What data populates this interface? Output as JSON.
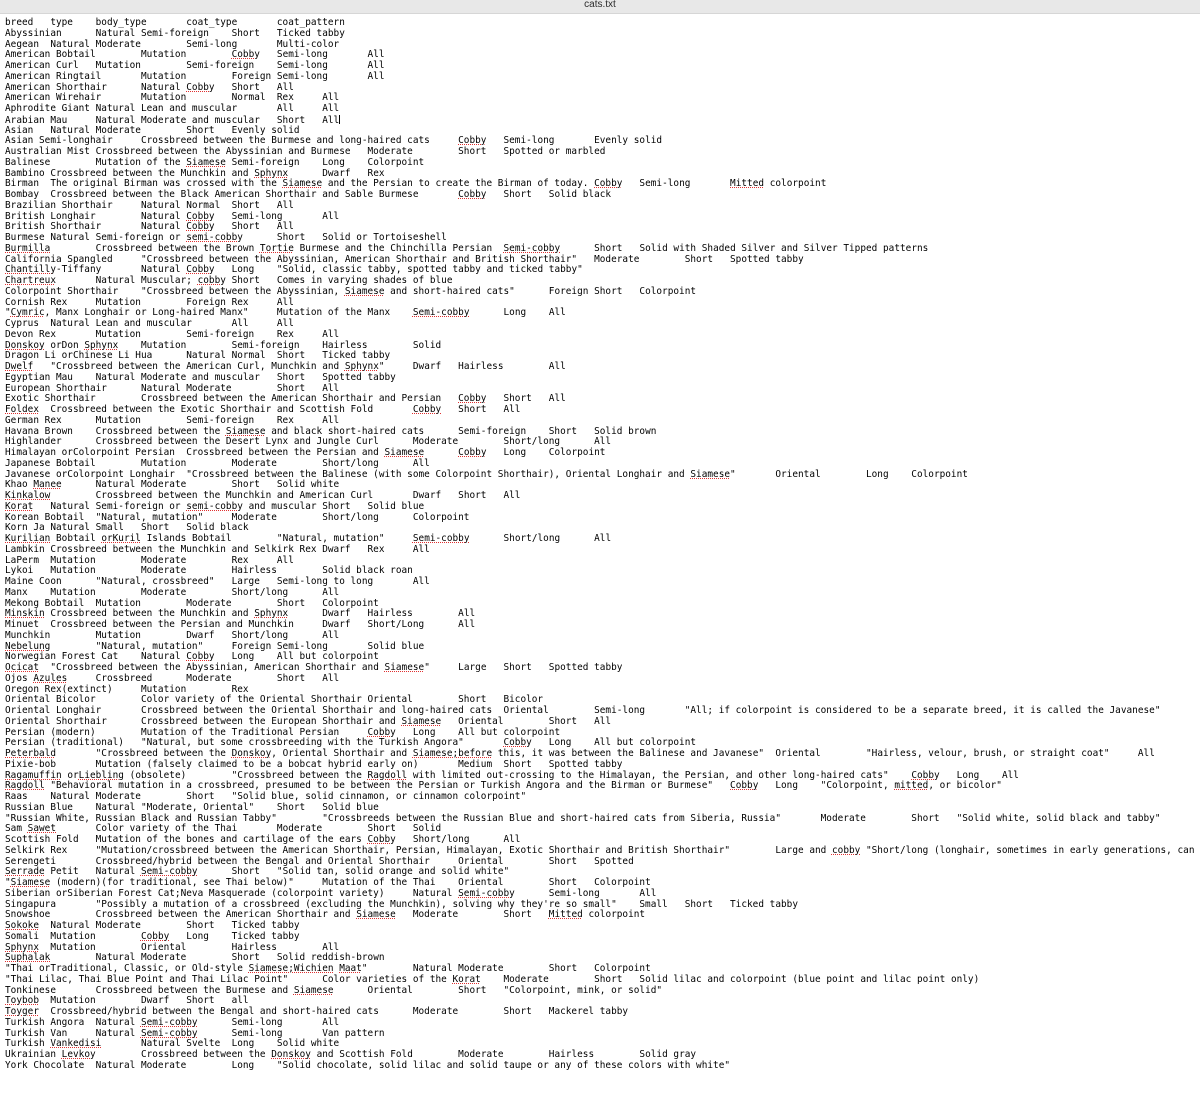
{
  "window": {
    "title": "cats.txt"
  },
  "editor": {
    "tab_size": 8,
    "caret_line_index": 10,
    "misspelled_words": [
      "Cobby",
      "cobby",
      "Sphynx",
      "Mitted",
      "mitted",
      "Burmilla",
      "Tortie",
      "Semi-cobby",
      "semi-cobby",
      "Chantilly",
      "Chartreux",
      "Cymric",
      "Donskoy",
      "Dwelf",
      "Foldex",
      "Manee",
      "Kinkalow",
      "Korat",
      "Kuril",
      "Kurilian",
      "Minskin",
      "Nebelung",
      "Ocicat",
      "Azules",
      "Peterbald",
      "Siamese",
      "Ragdoll",
      "Ragamuffin",
      "Liebling",
      "Sawet",
      "Serrade",
      "Siamese;Wichien",
      "Maat",
      "Sokoke",
      "Suphalak",
      "Toybob",
      "Toyger",
      "Vankedisi",
      "Levkoy",
      "Siamese;before",
      "orKuril",
      "Wichien"
    ],
    "colors": {
      "background": "#ffffff",
      "text": "#000000",
      "titlebar_background": "#e8e8e8",
      "spellcheck_underline": "#e03030"
    },
    "header_columns": [
      "breed",
      "type",
      "body_type",
      "coat_type",
      "coat_pattern"
    ],
    "lines": [
      "breed\ttype\tbody_type\tcoat_type\tcoat_pattern",
      "Abyssinian\tNatural\tSemi-foreign\tShort\tTicked tabby",
      "Aegean\tNatural\tModerate\tSemi-long\tMulti-color",
      "American Bobtail\tMutation\tCobby\tSemi-long\tAll",
      "American Curl\tMutation\tSemi-foreign\tSemi-long\tAll",
      "American Ringtail\tMutation\tForeign\tSemi-long\tAll",
      "American Shorthair\tNatural\tCobby\tShort\tAll",
      "American Wirehair\tMutation\tNormal\tRex\tAll",
      "Aphrodite Giant\tNatural\tLean and muscular\tAll\tAll",
      "Arabian Mau\tNatural\tModerate and muscular\tShort\tAll",
      "Asian\tNatural\tModerate\tShort\tEvenly solid",
      "Asian Semi-longhair\tCrossbreed between the Burmese and long-haired cats\tCobby\tSemi-long\tEvenly solid",
      "Australian Mist\tCrossbreed between the Abyssinian and Burmese\tModerate\tShort\tSpotted or marbled",
      "Balinese\tMutation of the Siamese\tSemi-foreign\tLong\tColorpoint",
      "Bambino\tCrossbreed between the Munchkin and Sphynx\tDwarf\tRex",
      "Birman\tThe original Birman was crossed with the Siamese and the Persian to create the Birman of today.\tCobby\tSemi-long\tMitted colorpoint",
      "Bombay\tCrossbreed between the Black American Shorthair and Sable Burmese\tCobby\tShort\tSolid black",
      "Brazilian Shorthair\tNatural\tNormal\tShort\tAll",
      "British Longhair\tNatural\tCobby\tSemi-long\tAll",
      "British Shorthair\tNatural\tCobby\tShort\tAll",
      "Burmese\tNatural\tSemi-foreign or semi-cobby\tShort\tSolid or Tortoiseshell",
      "Burmilla\tCrossbreed between the Brown Tortie Burmese and the Chinchilla Persian\tSemi-cobby\tShort\tSolid with Shaded Silver and Silver Tipped patterns",
      "California Spangled\t\"Crossbreed between the Abyssinian, American Shorthair and British Shorthair\"\tModerate\tShort\tSpotted tabby",
      "Chantilly-Tiffany\tNatural\tCobby\tLong\t\"Solid, classic tabby, spotted tabby and ticked tabby\"",
      "Chartreux\tNatural\tMuscular; cobby\tShort\tComes in varying shades of blue",
      "Colorpoint Shorthair\t\"Crossbreed between the Abyssinian, Siamese and short-haired cats\"\tForeign\tShort\tColorpoint",
      "Cornish Rex\tMutation\tForeign\tRex\tAll",
      "\"Cymric, Manx Longhair or Long-haired Manx\"\tMutation of the Manx\tSemi-cobby\tLong\tAll",
      "Cyprus\tNatural\tLean and muscular\tAll\tAll",
      "Devon Rex\tMutation\tSemi-foreign\tRex\tAll",
      "Donskoy orDon Sphynx\tMutation\tSemi-foreign\tHairless\tSolid",
      "Dragon Li orChinese Li Hua\tNatural\tNormal\tShort\tTicked tabby",
      "Dwelf\t\"Crossbreed between the American Curl, Munchkin and Sphynx\"\tDwarf\tHairless\tAll",
      "Egyptian Mau\tNatural\tModerate and muscular\tShort\tSpotted tabby",
      "European Shorthair\tNatural\tModerate\tShort\tAll",
      "Exotic Shorthair\tCrossbreed between the American Shorthair and Persian\tCobby\tShort\tAll",
      "Foldex\tCrossbreed between the Exotic Shorthair and Scottish Fold\tCobby\tShort\tAll",
      "German Rex\tMutation\tSemi-foreign\tRex\tAll",
      "Havana Brown\tCrossbreed between the Siamese and black short-haired cats\tSemi-foreign\tShort\tSolid brown",
      "Highlander\tCrossbreed between the Desert Lynx and Jungle Curl\tModerate\tShort/long\tAll",
      "Himalayan orColorpoint Persian\tCrossbreed between the Persian and Siamese\tCobby\tLong\tColorpoint",
      "Japanese Bobtail\tMutation\tModerate\tShort/long\tAll",
      "Javanese orColorpoint Longhair\t\"Crossbreed between the Balinese (with some Colorpoint Shorthair), Oriental Longhair and Siamese\"\tOriental\tLong\tColorpoint",
      "Khao Manee\tNatural\tModerate\tShort\tSolid white",
      "Kinkalow\tCrossbreed between the Munchkin and American Curl\tDwarf\tShort\tAll",
      "Korat\tNatural\tSemi-foreign or semi-cobby and muscular\tShort\tSolid blue",
      "Korean Bobtail\t\"Natural, mutation\"\tModerate\tShort/long\tColorpoint",
      "Korn Ja\tNatural\tSmall\tShort\tSolid black",
      "Kurilian Bobtail orKuril Islands Bobtail\t\"Natural, mutation\"\tSemi-cobby\tShort/long\tAll",
      "Lambkin\tCrossbreed between the Munchkin and Selkirk Rex\tDwarf\tRex\tAll",
      "LaPerm\tMutation\tModerate\tRex\tAll",
      "Lykoi\tMutation\tModerate\tHairless\tSolid black roan",
      "Maine Coon\t\"Natural, crossbreed\"\tLarge\tSemi-long to long\tAll",
      "Manx\tMutation\tModerate\tShort/long\tAll",
      "Mekong Bobtail\tMutation\tModerate\tShort\tColorpoint",
      "Minskin\tCrossbreed between the Munchkin and Sphynx\tDwarf\tHairless\tAll",
      "Minuet\tCrossbreed between the Persian and Munchkin\tDwarf\tShort/Long\tAll",
      "Munchkin\tMutation\tDwarf\tShort/long\tAll",
      "Nebelung\t\"Natural, mutation\"\tForeign\tSemi-long\tSolid blue",
      "Norwegian Forest Cat\tNatural\tCobby\tLong\tAll but colorpoint",
      "Ocicat\t\"Crossbreed between the Abyssinian, American Shorthair and Siamese\"\tLarge\tShort\tSpotted tabby",
      "Ojos Azules\tCrossbreed\tModerate\tShort\tAll",
      "Oregon Rex(extinct)\tMutation\tRex",
      "Oriental Bicolor\tColor variety of the Oriental Shorthair\tOriental\tShort\tBicolor",
      "Oriental Longhair\tCrossbreed between the Oriental Shorthair and long-haired cats\tOriental\tSemi-long\t\"All; if colorpoint is considered to be a separate breed, it is called the Javanese\"",
      "Oriental Shorthair\tCrossbreed between the European Shorthair and Siamese\tOriental\tShort\tAll",
      "Persian (modern)\tMutation of the Traditional Persian\tCobby\tLong\tAll but colorpoint",
      "Persian (traditional)\t\"Natural, but some crossbreeding with the Turkish Angora\"\tCobby\tLong\tAll but colorpoint",
      "Peterbald\t\"Crossbreed between the Donskoy, Oriental Shorthair and Siamese;before this, it was between the Balinese and Javanese\"\tOriental\t\"Hairless, velour, brush, or straight coat\"\tAll",
      "Pixie-bob\tMutation (falsely claimed to be a bobcat hybrid early on)\tMedium\tShort\tSpotted tabby",
      "Ragamuffin orLiebling (obsolete)\t\"Crossbreed between the Ragdoll with limited out-crossing to the Himalayan, the Persian, and other long-haired cats\"\tCobby\tLong\tAll",
      "Ragdoll\t\"Behavioral mutation in a crossbreed, presumed to be between the Persian or Turkish Angora and the Birman or Burmese\"\tCobby\tLong\t\"Colorpoint, mitted, or bicolor\"",
      "Raas\tNatural\tModerate\tShort\t\"Solid blue, solid cinnamon, or cinnamon colorpoint\"",
      "Russian Blue\tNatural\t\"Moderate, Oriental\"\tShort\tSolid blue",
      "\"Russian White, Russian Black and Russian Tabby\"\t\"Crossbreeds between the Russian Blue and short-haired cats from Siberia, Russia\"\tModerate\tShort\t\"Solid white, solid black and tabby\"",
      "Sam Sawet\tColor variety of the Thai\tModerate\tShort\tSolid",
      "Scottish Fold\tMutation of the bones and cartilage of the ears\tCobby\tShort/long\tAll",
      "Selkirk Rex\t\"Mutation/crossbreed between the American Shorthair, Persian, Himalayan, Exotic Shorthair and British Shorthair\"\tLarge and cobby\t\"Short/long (longhair, sometimes in early generations, can appear to be semi-long)\"\tAll",
      "Serengeti\tCrossbreed/hybrid between the Bengal and Oriental Shorthair\tOriental\tShort\tSpotted",
      "Serrade Petit\tNatural\tSemi-cobby\tShort\t\"Solid tan, solid orange and solid white\"",
      "\"Siamese (modern)(for traditional, see Thai below)\"\tMutation of the Thai\tOriental\tShort\tColorpoint",
      "Siberian orSiberian Forest Cat;Neva Masquerade (colorpoint variety)\tNatural\tSemi-cobby\tSemi-long\tAll",
      "Singapura\t\"Possibly a mutation of a crossbreed (excluding the Munchkin), solving why they're so small\"\tSmall\tShort\tTicked tabby",
      "Snowshoe\tCrossbreed between the American Shorthair and Siamese\tModerate\tShort\tMitted colorpoint",
      "Sokoke\tNatural\tModerate\tShort\tTicked tabby",
      "Somali\tMutation\tCobby\tLong\tTicked tabby",
      "Sphynx\tMutation\tOriental\tHairless\tAll",
      "Suphalak\tNatural\tModerate\tShort\tSolid reddish-brown",
      "\"Thai orTraditional, Classic, or Old-style Siamese;Wichien Maat\"\tNatural\tModerate\tShort\tColorpoint",
      "\"Thai Lilac, Thai Blue Point and Thai Lilac Point\"\tColor varieties of the Korat\tModerate\tShort\tSolid lilac and colorpoint (blue point and lilac point only)",
      "Tonkinese\tCrossbreed between the Burmese and Siamese\tOriental\tShort\t\"Colorpoint, mink, or solid\"",
      "Toybob\tMutation\tDwarf\tShort\tall",
      "Toyger\tCrossbreed/hybrid between the Bengal and short-haired cats\tModerate\tShort\tMackerel tabby",
      "Turkish Angora\tNatural\tSemi-cobby\tSemi-long\tAll",
      "Turkish Van\tNatural\tSemi-cobby\tSemi-long\tVan pattern",
      "Turkish Vankedisi\tNatural\tSvelte\tLong\tSolid white",
      "Ukrainian Levkoy\tCrossbreed between the Donskoy and Scottish Fold\tModerate\tHairless\tSolid gray",
      "York Chocolate\tNatural\tModerate\tLong\t\"Solid chocolate, solid lilac and solid taupe or any of these colors with white\""
    ]
  }
}
